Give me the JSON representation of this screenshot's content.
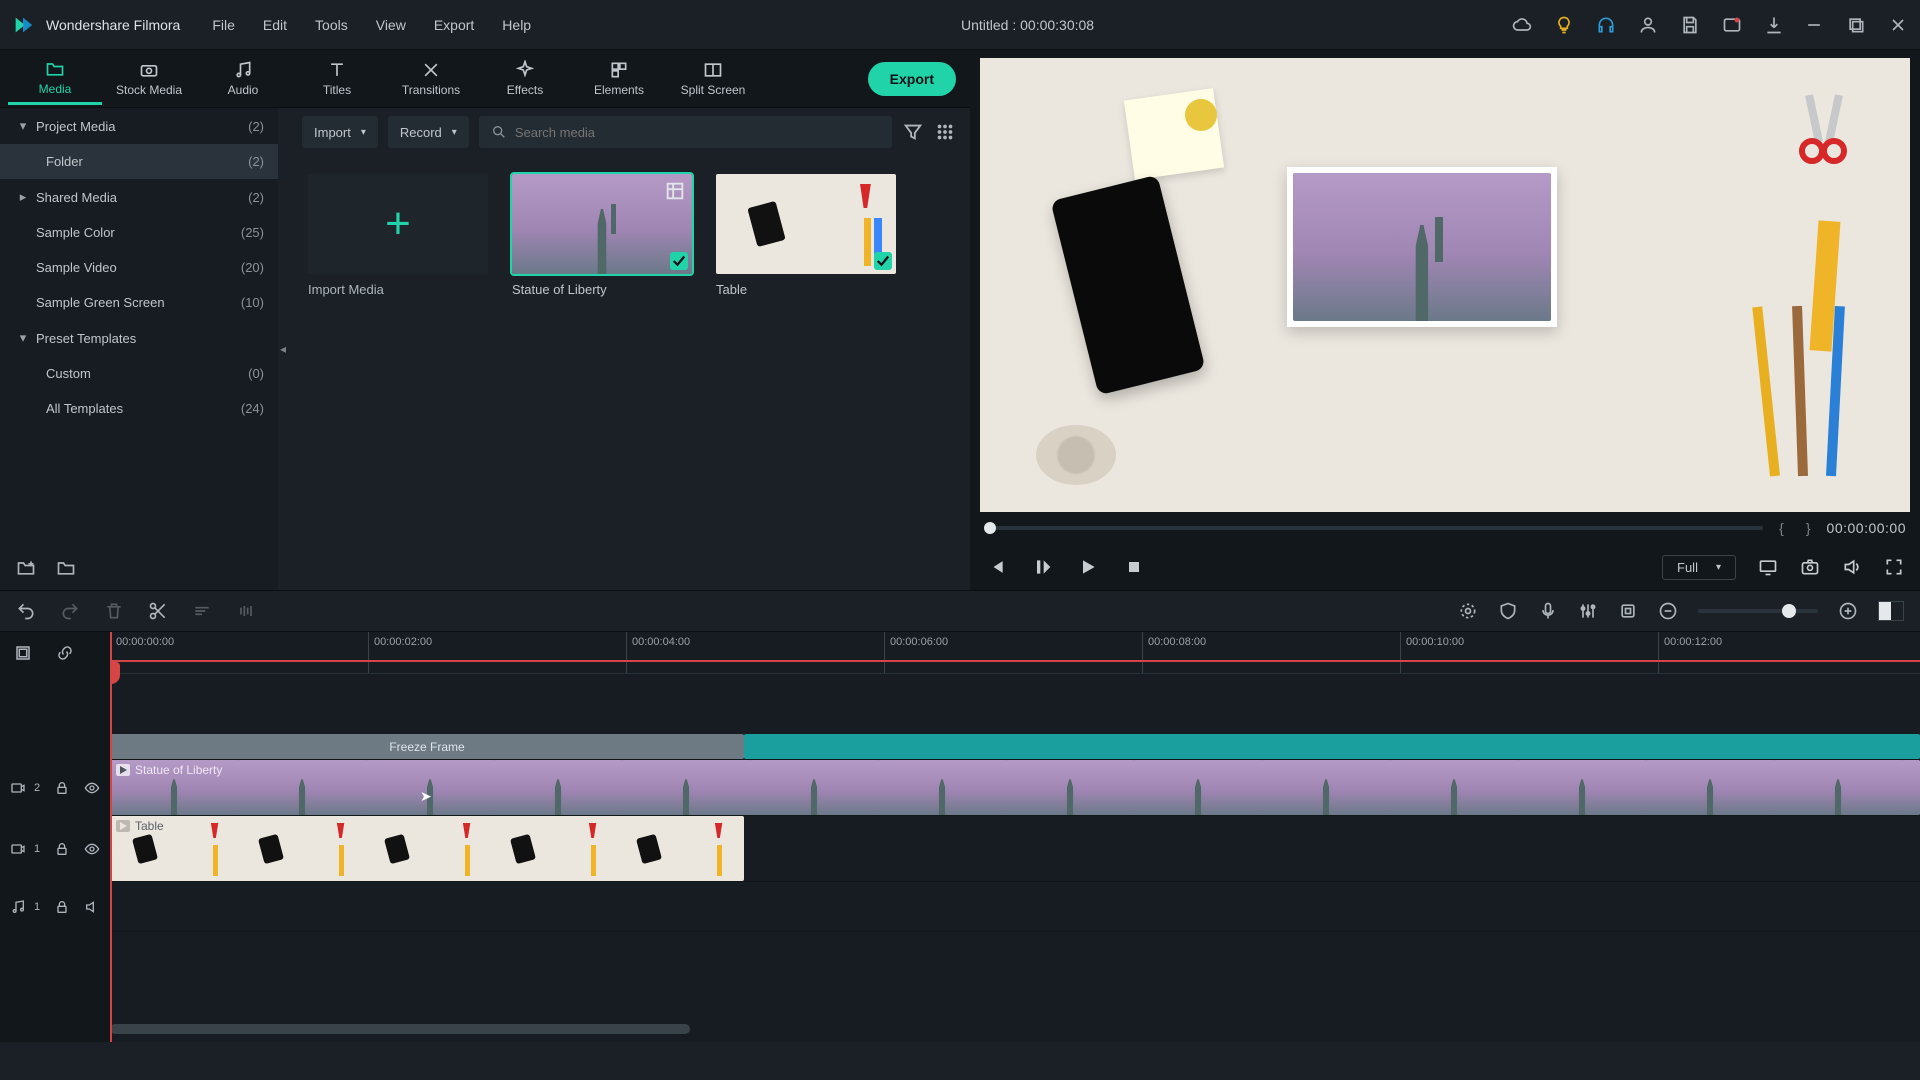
{
  "app": {
    "name": "Wondershare Filmora",
    "document_title": "Untitled : 00:00:30:08"
  },
  "menu": {
    "file": "File",
    "edit": "Edit",
    "tools": "Tools",
    "view": "View",
    "export": "Export",
    "help": "Help"
  },
  "tabs": {
    "media": "Media",
    "stock": "Stock Media",
    "audio": "Audio",
    "titles": "Titles",
    "transitions": "Transitions",
    "effects": "Effects",
    "elements": "Elements",
    "split": "Split Screen",
    "export_btn": "Export"
  },
  "sidebar": {
    "project_media": {
      "label": "Project Media",
      "count": "(2)"
    },
    "folder": {
      "label": "Folder",
      "count": "(2)"
    },
    "shared": {
      "label": "Shared Media",
      "count": "(2)"
    },
    "sample_color": {
      "label": "Sample Color",
      "count": "(25)"
    },
    "sample_video": {
      "label": "Sample Video",
      "count": "(20)"
    },
    "sample_green": {
      "label": "Sample Green Screen",
      "count": "(10)"
    },
    "preset": {
      "label": "Preset Templates"
    },
    "custom": {
      "label": "Custom",
      "count": "(0)"
    },
    "all_templates": {
      "label": "All Templates",
      "count": "(24)"
    }
  },
  "media_head": {
    "import": "Import",
    "record": "Record",
    "search_placeholder": "Search media"
  },
  "thumbs": {
    "import": "Import Media",
    "statue": "Statue of Liberty",
    "table": "Table"
  },
  "preview": {
    "time": "00:00:00:00",
    "full": "Full"
  },
  "ruler": {
    "t0": "00:00:00:00",
    "t2": "00:00:02:00",
    "t4": "00:00:04:00",
    "t6": "00:00:06:00",
    "t8": "00:00:08:00",
    "t10": "00:00:10:00",
    "t12": "00:00:12:00"
  },
  "tracks": {
    "freeze": "Freeze Frame",
    "statue_clip": "Statue of Liberty",
    "table_clip": "Table",
    "v2": "2",
    "v1": "1",
    "a1": "1"
  }
}
